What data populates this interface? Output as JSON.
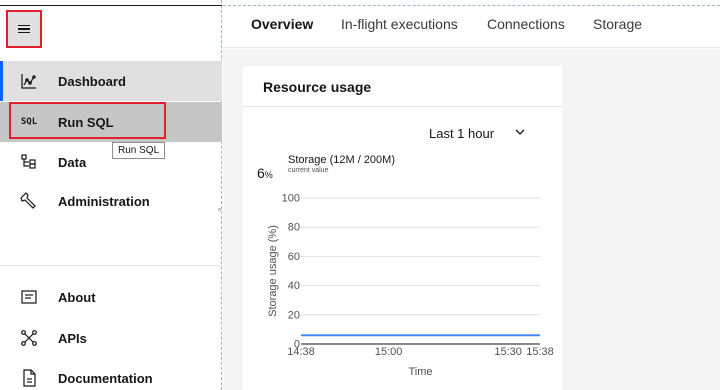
{
  "sidebar": {
    "items": [
      {
        "key": "dashboard",
        "label": "Dashboard",
        "icon": "chart-line-icon"
      },
      {
        "key": "runsql",
        "label": "Run SQL",
        "icon": "sql-icon",
        "icon_text": "SQL"
      },
      {
        "key": "data",
        "label": "Data",
        "icon": "data-structure-icon"
      },
      {
        "key": "admin",
        "label": "Administration",
        "icon": "wrench-icon"
      }
    ],
    "bottom_items": [
      {
        "key": "about",
        "label": "About",
        "icon": "info-card-icon"
      },
      {
        "key": "apis",
        "label": "APIs",
        "icon": "api-network-icon"
      },
      {
        "key": "docs",
        "label": "Documentation",
        "icon": "document-icon"
      }
    ],
    "tooltip": "Run SQL"
  },
  "tabs": [
    {
      "label": "Overview",
      "active": true
    },
    {
      "label": "In-flight executions",
      "active": false
    },
    {
      "label": "Connections",
      "active": false
    },
    {
      "label": "Storage",
      "active": false
    }
  ],
  "card": {
    "title": "Resource usage",
    "time_range": "Last 1 hour",
    "current_value": "6",
    "current_unit": "%",
    "metric_title": "Storage (12M / 200M)",
    "metric_subtitle": "current value"
  },
  "chart_data": {
    "type": "line",
    "xlabel": "Time",
    "ylabel": "Storage usage (%)",
    "ylim": [
      0,
      100
    ],
    "yticks": [
      0,
      20,
      40,
      60,
      80,
      100
    ],
    "xticks": [
      "14:38",
      "15:00",
      "15:30",
      "15:38"
    ],
    "grid": true,
    "series": [
      {
        "x": [
          "14:38",
          "15:38"
        ],
        "values": [
          6,
          6
        ],
        "color": "#4589ff"
      }
    ]
  },
  "colors": {
    "accent": "#0f62fe",
    "line": "#4589ff",
    "highlight": "#e0202a"
  }
}
